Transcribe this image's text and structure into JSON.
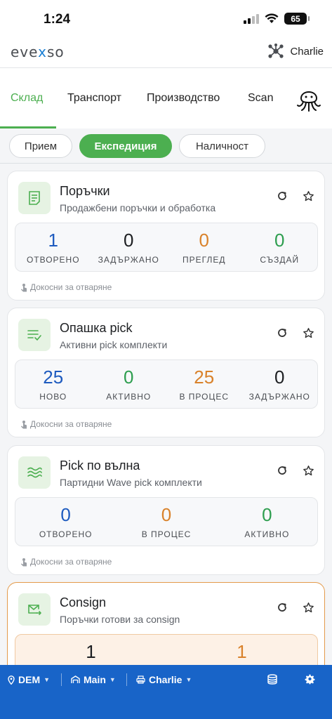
{
  "status_bar": {
    "time": "1:24",
    "battery": "65"
  },
  "header": {
    "logo_pre": "eve",
    "logo_x": "x",
    "logo_post": "so",
    "user_name": "Charlie"
  },
  "top_tabs": [
    "Склад",
    "Транспорт",
    "Производство",
    "Scan"
  ],
  "segments": [
    "Прием",
    "Експедиция",
    "Наличност"
  ],
  "colors": {
    "accent_green": "#4caf50",
    "blue": "#1e5bbf",
    "orange": "#d9822b",
    "green": "#2e9e4f",
    "bottom_bar": "#1864c8"
  },
  "cards": [
    {
      "title": "Поръчки",
      "subtitle": "Продажбени поръчки и обработка",
      "icon": "document-icon",
      "hint": "Докосни за отваряне",
      "stats": [
        {
          "value": "1",
          "label": "ОТВОРЕНО"
        },
        {
          "value": "0",
          "label": "ЗАДЪРЖАНО"
        },
        {
          "value": "0",
          "label": "ПРЕГЛЕД"
        },
        {
          "value": "0",
          "label": "СЪЗДАЙ"
        }
      ]
    },
    {
      "title": "Опашка pick",
      "subtitle": "Активни pick комплекти",
      "icon": "checklist-icon",
      "hint": "Докосни за отваряне",
      "stats": [
        {
          "value": "25",
          "label": "НОВО"
        },
        {
          "value": "0",
          "label": "АКТИВНО"
        },
        {
          "value": "25",
          "label": "В ПРОЦЕС"
        },
        {
          "value": "0",
          "label": "ЗАДЪРЖАНО"
        }
      ]
    },
    {
      "title": "Pick по вълна",
      "subtitle": "Партидни Wave pick комплекти",
      "icon": "wave-icon",
      "hint": "Докосни за отваряне",
      "stats": [
        {
          "value": "0",
          "label": "ОТВОРЕНО"
        },
        {
          "value": "0",
          "label": "В ПРОЦЕС"
        },
        {
          "value": "0",
          "label": "АКТИВНО"
        }
      ]
    },
    {
      "title": "Consign",
      "subtitle": "Поръчки готови за consign",
      "icon": "mail-out-icon",
      "stats": [
        {
          "value": "1"
        },
        {
          "value": "1"
        }
      ]
    }
  ],
  "bottom_bar": {
    "location": "DEM",
    "warehouse": "Main",
    "user": "Charlie"
  }
}
